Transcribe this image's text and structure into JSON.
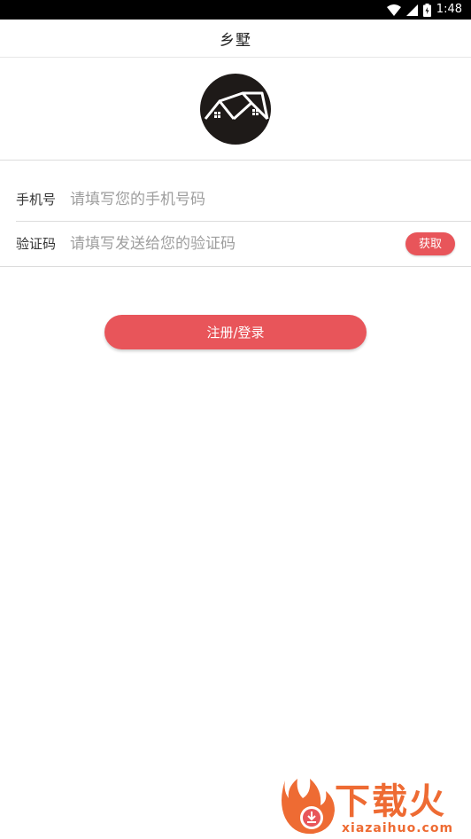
{
  "status_bar": {
    "time": "1:48",
    "icons": [
      "wifi-icon",
      "cell-signal-icon",
      "battery-icon"
    ]
  },
  "header": {
    "title": "乡墅"
  },
  "logo": {
    "icon": "house-roof-logo"
  },
  "form": {
    "phone": {
      "label": "手机号",
      "placeholder": "请填写您的手机号码",
      "value": ""
    },
    "code": {
      "label": "验证码",
      "placeholder": "请填写发送给您的验证码",
      "value": "",
      "get_code_label": "获取"
    },
    "submit_label": "注册/登录"
  },
  "watermark": {
    "brand": "下载火",
    "domain": "xiazaihuo.com"
  },
  "colors": {
    "accent": "#e8555a",
    "status_bar": "#000000",
    "logo_bg": "#1e1a18",
    "watermark": "#ee6b33"
  }
}
